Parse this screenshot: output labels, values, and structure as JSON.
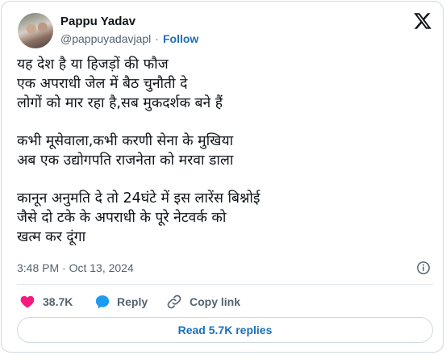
{
  "author": {
    "name": "Pappu Yadav",
    "handle": "@pappuyadavjapl",
    "separator": "·",
    "follow_label": "Follow"
  },
  "tweet": {
    "lines": [
      "यह देश है या हिजड़ों की फौज",
      "एक अपराधी जेल में बैठ चुनौती दे",
      "लोगों को मार रहा है,सब मुकदर्शक बने हैं",
      "",
      "कभी मूसेवाला,कभी करणी सेना के मुखिया",
      "अब एक उद्योगपति राजनेता को मरवा डाला",
      "",
      "कानून अनुमति दे तो 24घंटे में इस लारेंस बिश्नोई",
      "जैसे दो टके के अपराधी के पूरे नेटवर्क को",
      "खत्म कर दूंगा"
    ],
    "timestamp": "3:48 PM · Oct 13, 2024"
  },
  "actions": {
    "like_count": "38.7K",
    "reply_label": "Reply",
    "copy_label": "Copy link"
  },
  "read_replies_label": "Read 5.7K replies",
  "icons": {
    "logo": "x-logo-icon",
    "like": "heart-icon",
    "reply": "speech-bubble-icon",
    "copy": "link-icon",
    "info": "info-icon"
  },
  "colors": {
    "like": "#f91880",
    "reply": "#1d9bf0",
    "link": "#1d6fb8",
    "text": "#0f1419",
    "muted": "#536471"
  }
}
